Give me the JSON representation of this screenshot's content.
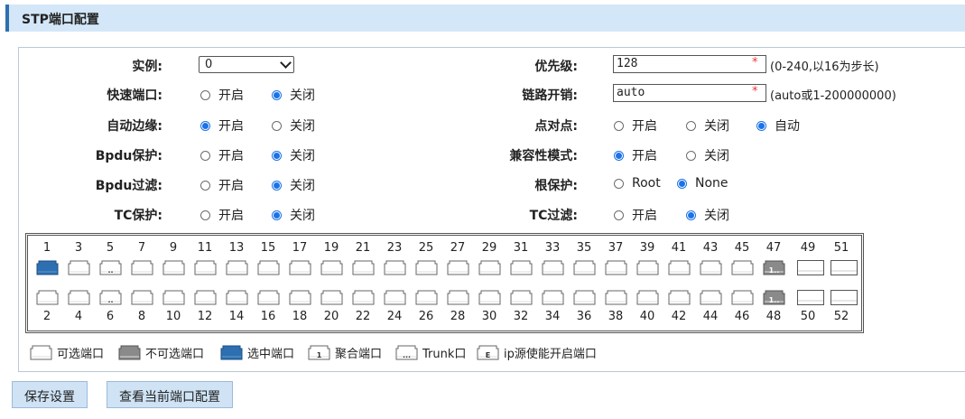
{
  "page_title": "STP端口配置",
  "left": {
    "instance": {
      "label": "实例:",
      "value": "0"
    },
    "fast_port": {
      "label": "快速端口:",
      "options": [
        "开启",
        "关闭"
      ],
      "selected": 1
    },
    "auto_edge": {
      "label": "自动边缘:",
      "options": [
        "开启",
        "关闭"
      ],
      "selected": 0
    },
    "bpdu_protect": {
      "label": "Bpdu保护:",
      "options": [
        "开启",
        "关闭"
      ],
      "selected": 1
    },
    "bpdu_filter": {
      "label": "Bpdu过滤:",
      "options": [
        "开启",
        "关闭"
      ],
      "selected": 1
    },
    "tc_protect": {
      "label": "TC保护:",
      "options": [
        "开启",
        "关闭"
      ],
      "selected": 1
    }
  },
  "right": {
    "priority": {
      "label": "优先级:",
      "value": "128",
      "required": "*",
      "hint": "(0-240,以16为步长)"
    },
    "path_cost": {
      "label": "链路开销:",
      "value": "auto",
      "required": "*",
      "hint": "(auto或1-200000000)"
    },
    "point_to_point": {
      "label": "点对点:",
      "options": [
        "开启",
        "关闭",
        "自动"
      ],
      "selected": 2
    },
    "compat_mode": {
      "label": "兼容性模式:",
      "options": [
        "开启",
        "关闭"
      ],
      "selected": 0
    },
    "root_protect": {
      "label": "根保护:",
      "options": [
        "Root",
        "None"
      ],
      "selected": 1
    },
    "tc_filter": {
      "label": "TC过滤:",
      "options": [
        "开启",
        "关闭"
      ],
      "selected": 1
    }
  },
  "ports": {
    "top": [
      {
        "num": "1",
        "state": "selected"
      },
      {
        "num": "3",
        "state": "normal"
      },
      {
        "num": "5",
        "state": "trunk",
        "mark": ".."
      },
      {
        "num": "7",
        "state": "normal"
      },
      {
        "num": "9",
        "state": "normal"
      },
      {
        "num": "11",
        "state": "normal"
      },
      {
        "num": "13",
        "state": "normal"
      },
      {
        "num": "15",
        "state": "normal"
      },
      {
        "num": "17",
        "state": "normal"
      },
      {
        "num": "19",
        "state": "normal"
      },
      {
        "num": "21",
        "state": "normal"
      },
      {
        "num": "23",
        "state": "normal"
      },
      {
        "num": "25",
        "state": "normal"
      },
      {
        "num": "27",
        "state": "normal"
      },
      {
        "num": "29",
        "state": "normal"
      },
      {
        "num": "31",
        "state": "normal"
      },
      {
        "num": "33",
        "state": "normal"
      },
      {
        "num": "35",
        "state": "normal"
      },
      {
        "num": "37",
        "state": "normal"
      },
      {
        "num": "39",
        "state": "normal"
      },
      {
        "num": "41",
        "state": "normal"
      },
      {
        "num": "43",
        "state": "normal"
      },
      {
        "num": "45",
        "state": "normal"
      },
      {
        "num": "47",
        "state": "disabled",
        "mark": "1.."
      },
      {
        "num": "49",
        "state": "sfp"
      },
      {
        "num": "51",
        "state": "sfp"
      }
    ],
    "bottom": [
      {
        "num": "2",
        "state": "normal"
      },
      {
        "num": "4",
        "state": "normal"
      },
      {
        "num": "6",
        "state": "trunk",
        "mark": ".."
      },
      {
        "num": "8",
        "state": "normal"
      },
      {
        "num": "10",
        "state": "normal"
      },
      {
        "num": "12",
        "state": "normal"
      },
      {
        "num": "14",
        "state": "normal"
      },
      {
        "num": "16",
        "state": "normal"
      },
      {
        "num": "18",
        "state": "normal"
      },
      {
        "num": "20",
        "state": "normal"
      },
      {
        "num": "22",
        "state": "normal"
      },
      {
        "num": "24",
        "state": "normal"
      },
      {
        "num": "26",
        "state": "normal"
      },
      {
        "num": "28",
        "state": "normal"
      },
      {
        "num": "30",
        "state": "normal"
      },
      {
        "num": "32",
        "state": "normal"
      },
      {
        "num": "34",
        "state": "normal"
      },
      {
        "num": "36",
        "state": "normal"
      },
      {
        "num": "38",
        "state": "normal"
      },
      {
        "num": "40",
        "state": "normal"
      },
      {
        "num": "42",
        "state": "normal"
      },
      {
        "num": "44",
        "state": "normal"
      },
      {
        "num": "46",
        "state": "normal"
      },
      {
        "num": "48",
        "state": "disabled",
        "mark": "1.."
      },
      {
        "num": "50",
        "state": "sfp"
      },
      {
        "num": "52",
        "state": "sfp"
      }
    ]
  },
  "legend": [
    {
      "icon": "port-selectable-icon",
      "label": "可选端口"
    },
    {
      "icon": "port-unselectable-icon",
      "label": "不可选端口"
    },
    {
      "icon": "port-selected-icon",
      "label": "选中端口"
    },
    {
      "icon": "port-aggregate-icon",
      "mark": "1",
      "label": "聚合端口"
    },
    {
      "icon": "port-trunk-icon",
      "mark": "...",
      "label": "Trunk口"
    },
    {
      "icon": "port-ip-source-icon",
      "mark": "E",
      "label": "ip源使能开启端口"
    }
  ],
  "buttons": {
    "save": "保存设置",
    "view_current": "查看当前端口配置"
  },
  "colors": {
    "selected_port": "#2d6fb0",
    "disabled_port": "#8a8a8a",
    "title_bar": "#d3e7f8",
    "accent": "#2f6fae"
  }
}
